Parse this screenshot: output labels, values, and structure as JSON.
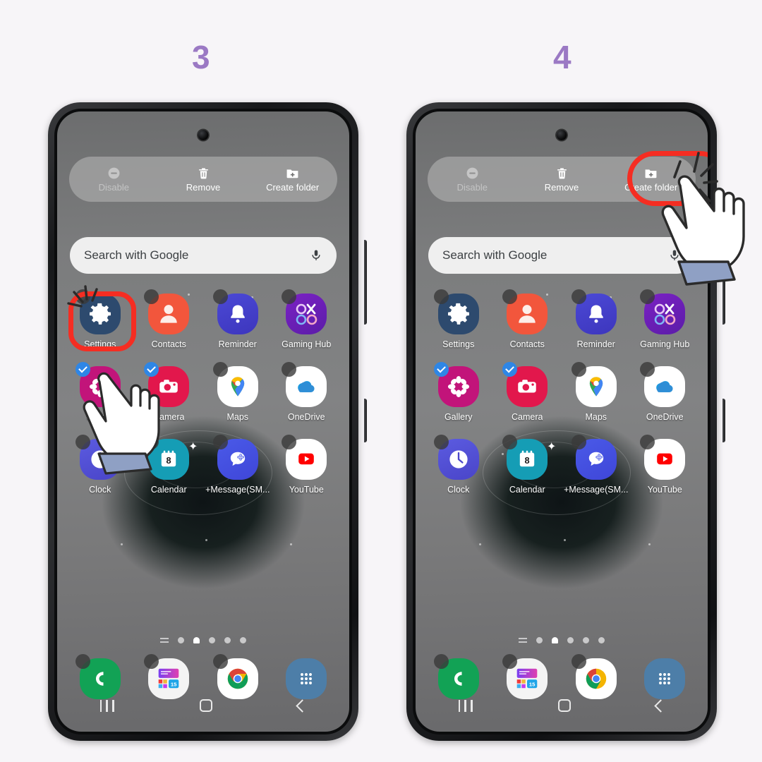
{
  "page": {
    "background_color": "#f7f5f8",
    "step_number_color": "#9b79c4",
    "highlight_color": "#f52d22"
  },
  "steps": [
    {
      "number": "3"
    },
    {
      "number": "4"
    }
  ],
  "phone": {
    "toolbar": {
      "items": [
        {
          "label": "Disable",
          "icon": "minus-circle-icon",
          "state": "disabled"
        },
        {
          "label": "Remove",
          "icon": "trash-icon",
          "state": "enabled"
        },
        {
          "label": "Create folder",
          "icon": "folder-add-icon",
          "state": "enabled"
        }
      ]
    },
    "search": {
      "placeholder": "Search with Google",
      "mic_icon": "microphone-icon"
    },
    "apps": [
      {
        "label": "Settings",
        "icon": "settings-gear-icon",
        "selected": false
      },
      {
        "label": "Contacts",
        "icon": "contacts-person-icon",
        "selected": false
      },
      {
        "label": "Reminder",
        "icon": "bell-icon",
        "selected": false
      },
      {
        "label": "Gaming Hub",
        "icon": "gaming-hub-icon",
        "selected": false
      },
      {
        "label": "Gallery",
        "icon": "gallery-flower-icon",
        "selected": true
      },
      {
        "label": "Camera",
        "icon": "camera-icon",
        "selected": true
      },
      {
        "label": "Maps",
        "icon": "google-maps-icon",
        "selected": false
      },
      {
        "label": "OneDrive",
        "icon": "onedrive-cloud-icon",
        "selected": false
      },
      {
        "label": "Clock",
        "icon": "clock-icon",
        "selected": false
      },
      {
        "label": "Calendar",
        "icon": "calendar-icon",
        "selected": false,
        "badge_day": "8"
      },
      {
        "label": "+Message(SM...",
        "icon": "plus-message-icon",
        "selected": false
      },
      {
        "label": "YouTube",
        "icon": "youtube-icon",
        "selected": false
      }
    ],
    "dock": [
      {
        "label": "Phone",
        "icon": "phone-handset-icon"
      },
      {
        "label": "Samsung",
        "icon": "samsung-apps-icon",
        "badge_day": "15"
      },
      {
        "label": "Chrome",
        "icon": "chrome-icon"
      },
      {
        "label": "Apps",
        "icon": "app-drawer-icon"
      }
    ],
    "page_indicator": {
      "count": 5,
      "active_index": 2,
      "has_menu_glyph": true
    },
    "navbar": [
      {
        "label": "Recents",
        "icon": "recents-icon"
      },
      {
        "label": "Home",
        "icon": "home-icon"
      },
      {
        "label": "Back",
        "icon": "back-icon"
      }
    ]
  },
  "annotations": {
    "left_phone": {
      "highlight_target": "Gallery",
      "cursor": "hand-pointer-icon",
      "tap_burst": true
    },
    "right_phone": {
      "highlight_target": "Create folder",
      "cursor": "hand-pointer-icon",
      "tap_burst": true
    }
  }
}
